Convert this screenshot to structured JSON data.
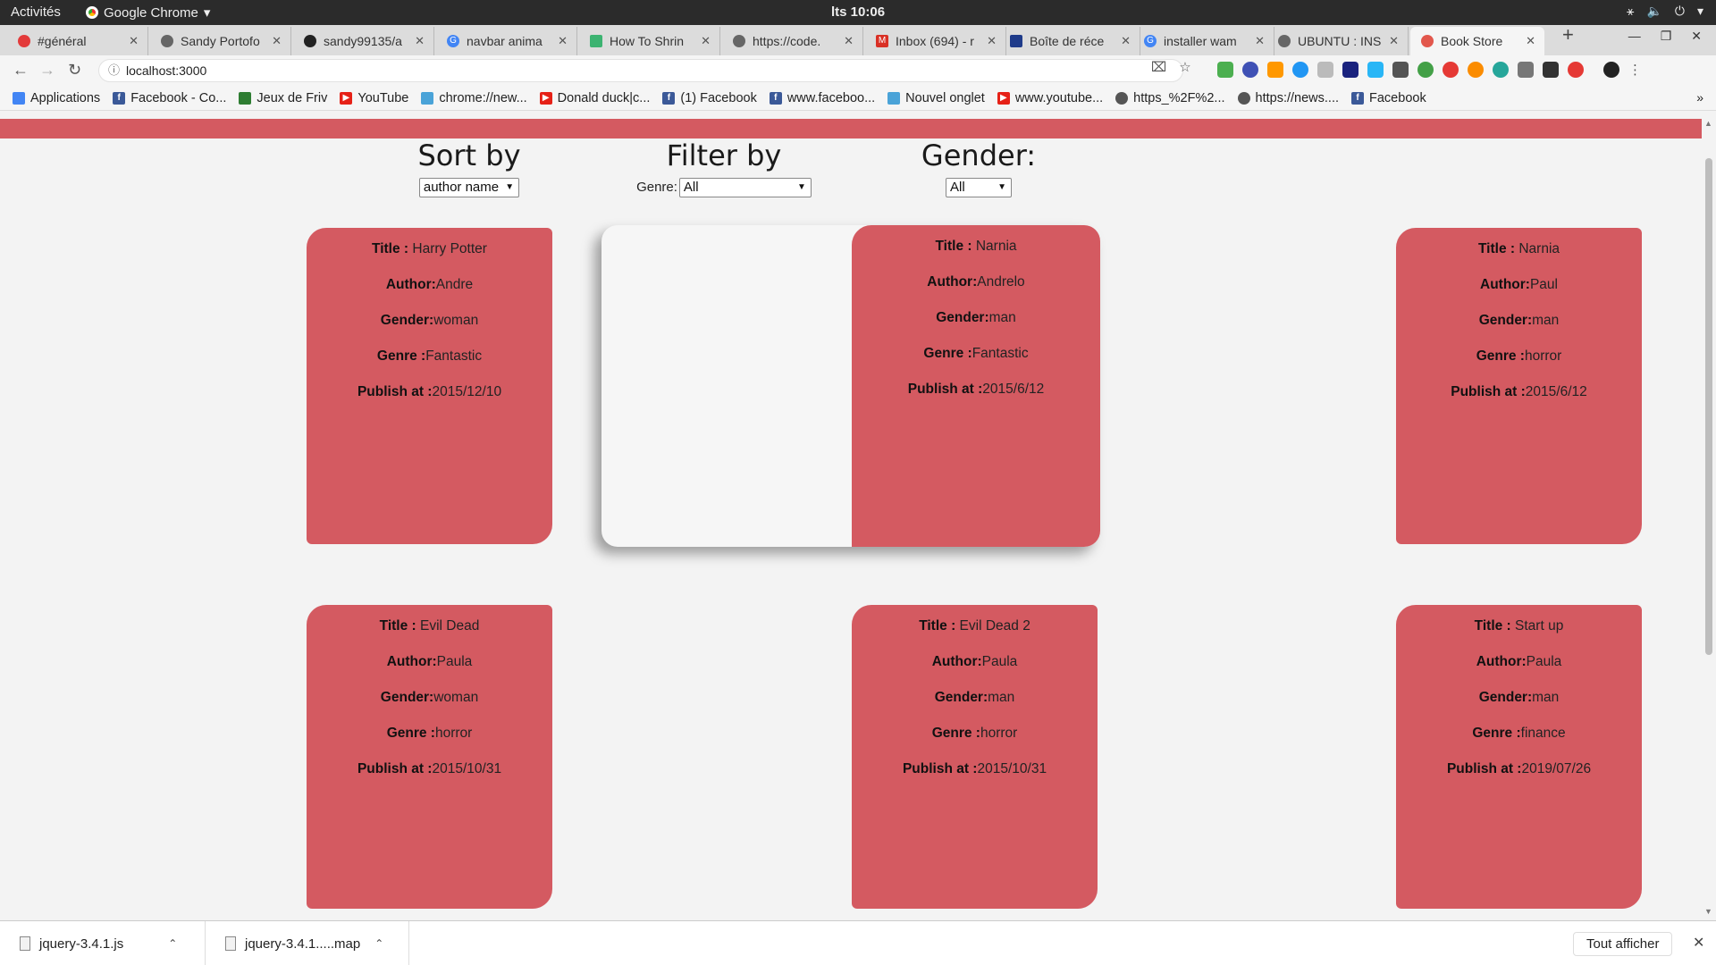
{
  "topbar": {
    "activities": "Activités",
    "app_name": "Google Chrome",
    "clock": "lts 10:06"
  },
  "tabs": [
    {
      "label": "#général",
      "color": "#e33b3b"
    },
    {
      "label": "Sandy Portofo",
      "color": "#666666"
    },
    {
      "label": "sandy99135/a",
      "color": "#222222"
    },
    {
      "label": "navbar anima",
      "color": "#4285f4"
    },
    {
      "label": "How To Shrin",
      "color": "#3cb371"
    },
    {
      "label": "https://code.",
      "color": "#666666"
    },
    {
      "label": "Inbox (694) - r",
      "color": "#d93025"
    },
    {
      "label": "Boîte de réce",
      "color": "#1f3b8a"
    },
    {
      "label": "installer wam",
      "color": "#4285f4"
    },
    {
      "label": "UBUNTU : INS",
      "color": "#666666"
    },
    {
      "label": "Book Store",
      "color": "#e2574c"
    }
  ],
  "address": {
    "url": "localhost:3000"
  },
  "bookmarks": [
    {
      "label": "Applications",
      "color": "#4285f4",
      "glyph": "⋮"
    },
    {
      "label": "Facebook - Co...",
      "color": "#3b5998",
      "glyph": "f"
    },
    {
      "label": "Jeux de Friv",
      "color": "#2e7d32",
      "glyph": "₩"
    },
    {
      "label": "YouTube",
      "color": "#e62117",
      "glyph": "▶"
    },
    {
      "label": "chrome://new...",
      "color": "#4aa3d8",
      "glyph": "⌂"
    },
    {
      "label": "Donald duck|c...",
      "color": "#e62117",
      "glyph": "▶"
    },
    {
      "label": "(1) Facebook",
      "color": "#3b5998",
      "glyph": "f"
    },
    {
      "label": "www.faceboo...",
      "color": "#3b5998",
      "glyph": "f"
    },
    {
      "label": "Nouvel onglet",
      "color": "#4aa3d8",
      "glyph": "⌂"
    },
    {
      "label": "www.youtube...",
      "color": "#e62117",
      "glyph": "▶"
    },
    {
      "label": "https_%2F%2...",
      "color": "#555555",
      "glyph": "◐"
    },
    {
      "label": "https://news....",
      "color": "#555555",
      "glyph": "◐"
    },
    {
      "label": "Facebook",
      "color": "#3b5998",
      "glyph": "f"
    }
  ],
  "controls": {
    "sort_title": "Sort by",
    "sort_value": "author name",
    "filter_title": "Filter by",
    "genre_label": "Genre:",
    "genre_value": "All",
    "gender_title": "Gender:",
    "gender_value": "All"
  },
  "field_labels": {
    "title": "Title : ",
    "author": "Author:",
    "gender": "Gender:",
    "genre": "Genre :",
    "publish": "Publish at :"
  },
  "books": [
    {
      "title": "Harry Potter",
      "author": "Andre",
      "gender": "woman",
      "genre": "Fantastic",
      "publish": "2015/12/10"
    },
    {
      "title": "Narnia",
      "author": "Andrelo",
      "gender": "man",
      "genre": "Fantastic",
      "publish": "2015/6/12"
    },
    {
      "title": "Narnia",
      "author": "Paul",
      "gender": "man",
      "genre": "horror",
      "publish": "2015/6/12"
    },
    {
      "title": "Evil Dead",
      "author": "Paula",
      "gender": "woman",
      "genre": "horror",
      "publish": "2015/10/31"
    },
    {
      "title": "Evil Dead 2",
      "author": "Paula",
      "gender": "man",
      "genre": "horror",
      "publish": "2015/10/31"
    },
    {
      "title": "Start up",
      "author": "Paula",
      "gender": "man",
      "genre": "finance",
      "publish": "2019/07/26"
    }
  ],
  "downloads": {
    "items": [
      "jquery-3.4.1.js",
      "jquery-3.4.1.....map"
    ],
    "show_all": "Tout afficher"
  },
  "colors": {
    "accent": "#d45a61"
  }
}
